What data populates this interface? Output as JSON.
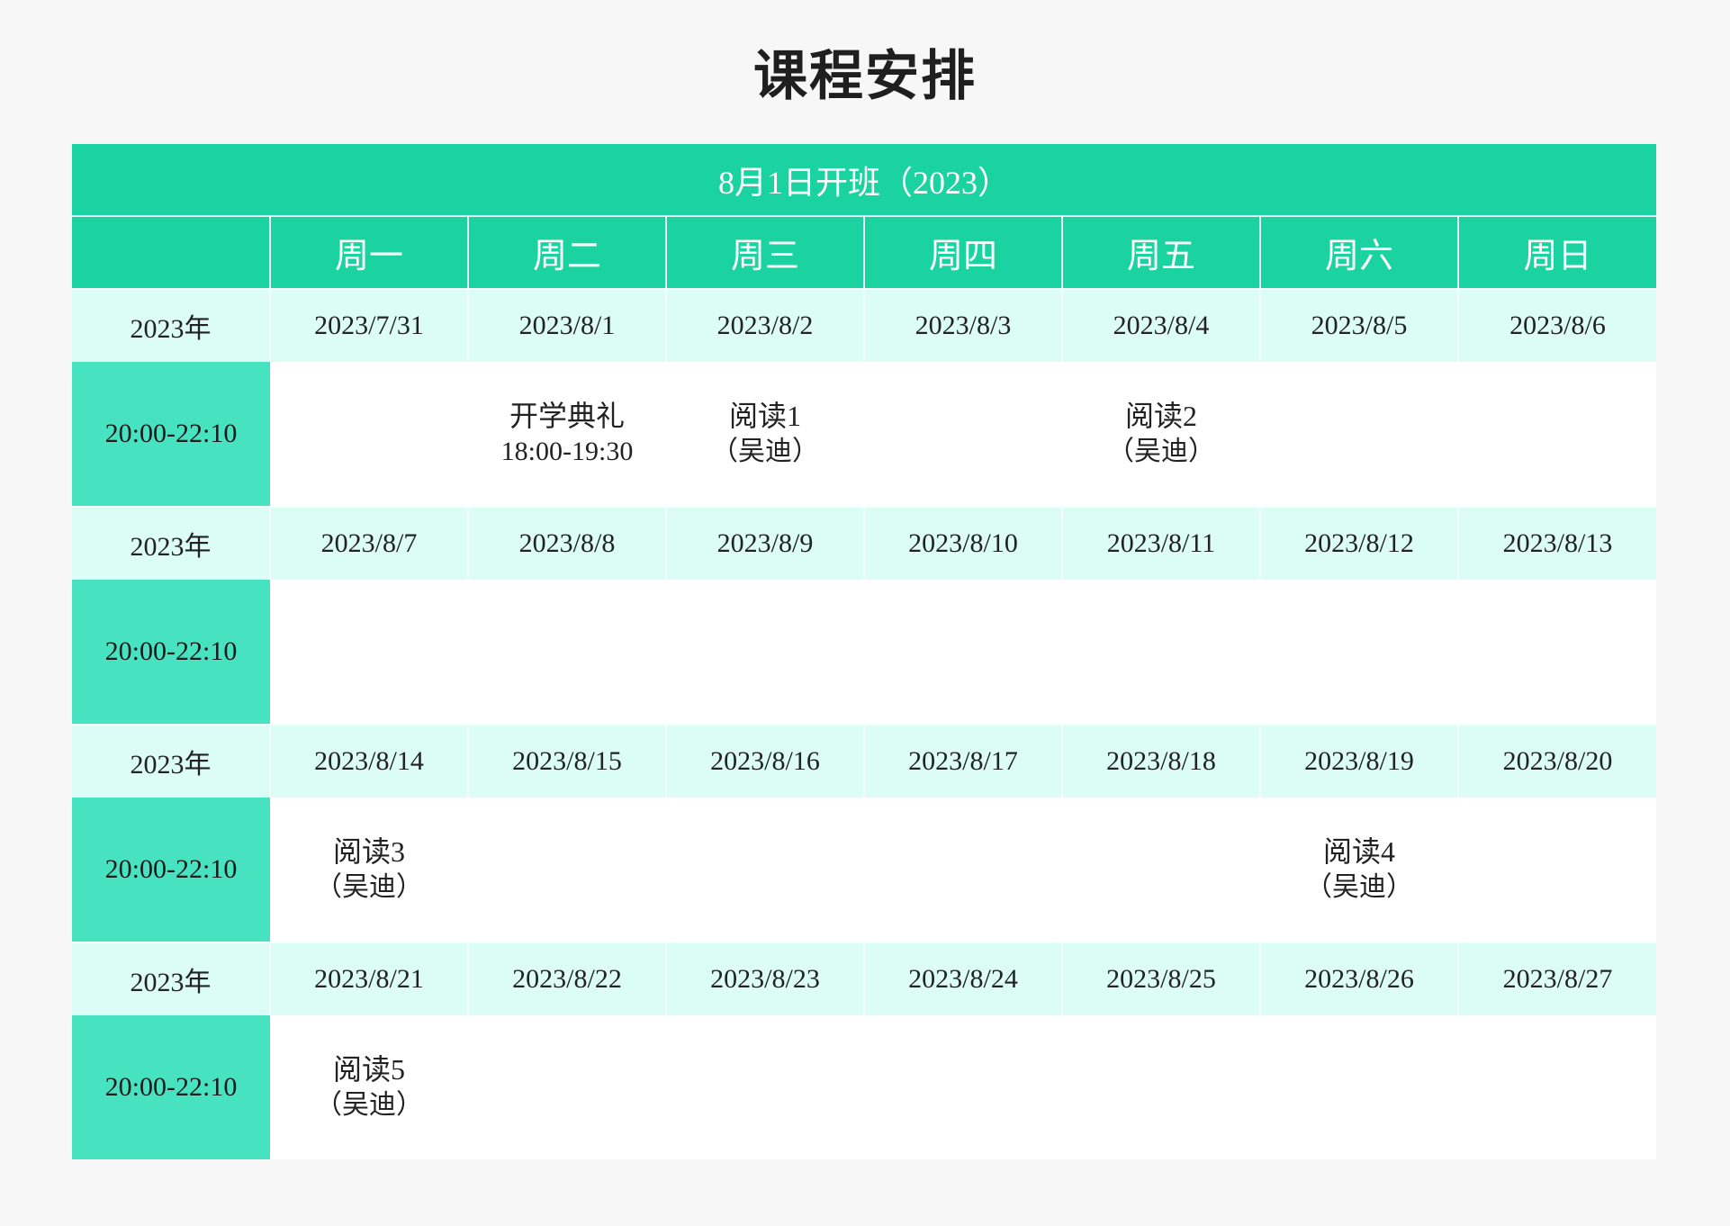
{
  "title": "课程安排",
  "banner": "8月1日开班（2023）",
  "weekdays": [
    "",
    "周一",
    "周二",
    "周三",
    "周四",
    "周五",
    "周六",
    "周日"
  ],
  "weeks": [
    {
      "year_label": "2023年",
      "time_label": "20:00-22:10",
      "dates": [
        "2023/7/31",
        "2023/8/1",
        "2023/8/2",
        "2023/8/3",
        "2023/8/4",
        "2023/8/5",
        "2023/8/6"
      ],
      "events": [
        null,
        {
          "name": "开学典礼",
          "sub": "18:00-19:30"
        },
        {
          "name": "阅读1",
          "sub": "（吴迪）"
        },
        null,
        {
          "name": "阅读2",
          "sub": "（吴迪）"
        },
        null,
        null
      ]
    },
    {
      "year_label": "2023年",
      "time_label": "20:00-22:10",
      "dates": [
        "2023/8/7",
        "2023/8/8",
        "2023/8/9",
        "2023/8/10",
        "2023/8/11",
        "2023/8/12",
        "2023/8/13"
      ],
      "events": [
        null,
        null,
        null,
        null,
        null,
        null,
        null
      ]
    },
    {
      "year_label": "2023年",
      "time_label": "20:00-22:10",
      "dates": [
        "2023/8/14",
        "2023/8/15",
        "2023/8/16",
        "2023/8/17",
        "2023/8/18",
        "2023/8/19",
        "2023/8/20"
      ],
      "events": [
        {
          "name": "阅读3",
          "sub": "（吴迪）"
        },
        null,
        null,
        null,
        null,
        {
          "name": "阅读4",
          "sub": "（吴迪）"
        },
        null
      ]
    },
    {
      "year_label": "2023年",
      "time_label": "20:00-22:10",
      "dates": [
        "2023/8/21",
        "2023/8/22",
        "2023/8/23",
        "2023/8/24",
        "2023/8/25",
        "2023/8/26",
        "2023/8/27"
      ],
      "events": [
        {
          "name": "阅读5",
          "sub": "（吴迪）"
        },
        null,
        null,
        null,
        null,
        null,
        null
      ]
    }
  ],
  "colors": {
    "header_green": "#1bd3a0",
    "time_cell_green": "#47e2c0",
    "date_row_bg": "#dcfdf5",
    "slot_bg": "#ffffff",
    "page_bg": "#f7f7f7"
  }
}
